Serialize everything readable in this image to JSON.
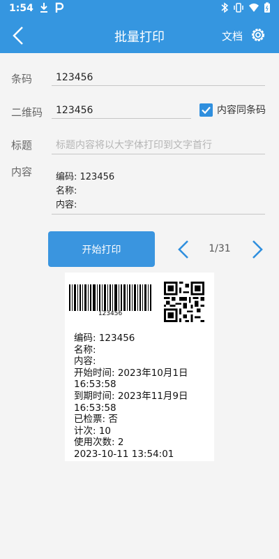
{
  "status_bar": {
    "time": "1:54"
  },
  "app_bar": {
    "title": "批量打印",
    "doc_link": "文档"
  },
  "form": {
    "barcode": {
      "label": "条码",
      "value": "123456"
    },
    "qrcode": {
      "label": "二维码",
      "value": "123456",
      "same_as_barcode_label": "内容同条码",
      "same_as_barcode_checked": true
    },
    "title": {
      "label": "标题",
      "placeholder": "标题内容将以大字体打印到文字首行"
    },
    "content": {
      "label": "内容",
      "lines": [
        "编码: 123456",
        "名称:",
        "内容:"
      ]
    }
  },
  "actions": {
    "print_label": "开始打印"
  },
  "pager": {
    "text": "1/31"
  },
  "preview": {
    "barcode_number": "123456",
    "lines": [
      "编码: 123456",
      "名称:",
      "内容:",
      "开始时间: 2023年10月1日",
      "16:53:58",
      "到期时间: 2023年11月9日",
      "16:53:58",
      "已检票: 否",
      "计次: 10",
      "使用次数: 2",
      "2023-10-11 13:54:01"
    ]
  },
  "colors": {
    "primary": "#3596e0",
    "button": "#3a95df"
  }
}
